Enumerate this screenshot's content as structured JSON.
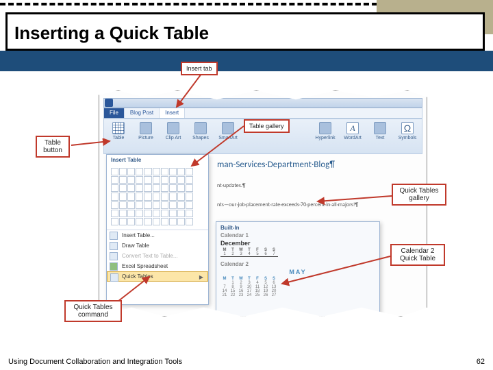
{
  "slide": {
    "title": "Inserting a Quick Table",
    "footer_text": "Using Document Collaboration and Integration Tools",
    "page_number": "62"
  },
  "callouts": {
    "insert_tab": "Insert tab",
    "table_button": "Table button",
    "table_gallery": "Table gallery",
    "quick_tables_gallery": "Quick Tables gallery",
    "calendar2_qt": "Calendar 2 Quick Table",
    "qt_command": "Quick Tables command"
  },
  "word": {
    "tabs": {
      "file": "File",
      "blogpost": "Blog Post",
      "insert": "Insert"
    },
    "ribbon": {
      "table": "Table",
      "picture": "Picture",
      "clipart": "Clip Art",
      "shapes": "Shapes",
      "smartart": "SmartArt",
      "hyperlink": "Hyperlink",
      "wordart": "WordArt",
      "text": "Text",
      "symbols": "Symbols"
    },
    "table_menu": {
      "header": "Insert Table",
      "insert_table": "Insert Table...",
      "draw_table": "Draw Table",
      "convert": "Convert Text to Table...",
      "excel": "Excel Spreadsheet",
      "quick_tables": "Quick Tables"
    },
    "qt_flyout": {
      "built_in": "Built-In",
      "cal1": "Calendar 1",
      "cal1_month": "December",
      "cal2": "Calendar 2",
      "cal2_month": "MAY",
      "days": [
        "M",
        "T",
        "W",
        "T",
        "F",
        "S",
        "S"
      ],
      "cal1_row": [
        "1",
        "2",
        "3",
        "4",
        "5",
        "6",
        "7"
      ],
      "cal2_rows": [
        [
          "",
          "1",
          "2",
          "3",
          "4",
          "5",
          "6"
        ],
        [
          "7",
          "8",
          "9",
          "10",
          "11",
          "12",
          "13"
        ],
        [
          "14",
          "15",
          "16",
          "17",
          "18",
          "19",
          "20"
        ],
        [
          "21",
          "22",
          "23",
          "24",
          "25",
          "26",
          "27"
        ]
      ]
    },
    "doc": {
      "heading": "man-Services·Department·Blog¶",
      "line1": "nt·updates.¶",
      "line2": "nts—our·job·placement·rate·exceeds·70·percent·in·all·majors!¶"
    }
  }
}
